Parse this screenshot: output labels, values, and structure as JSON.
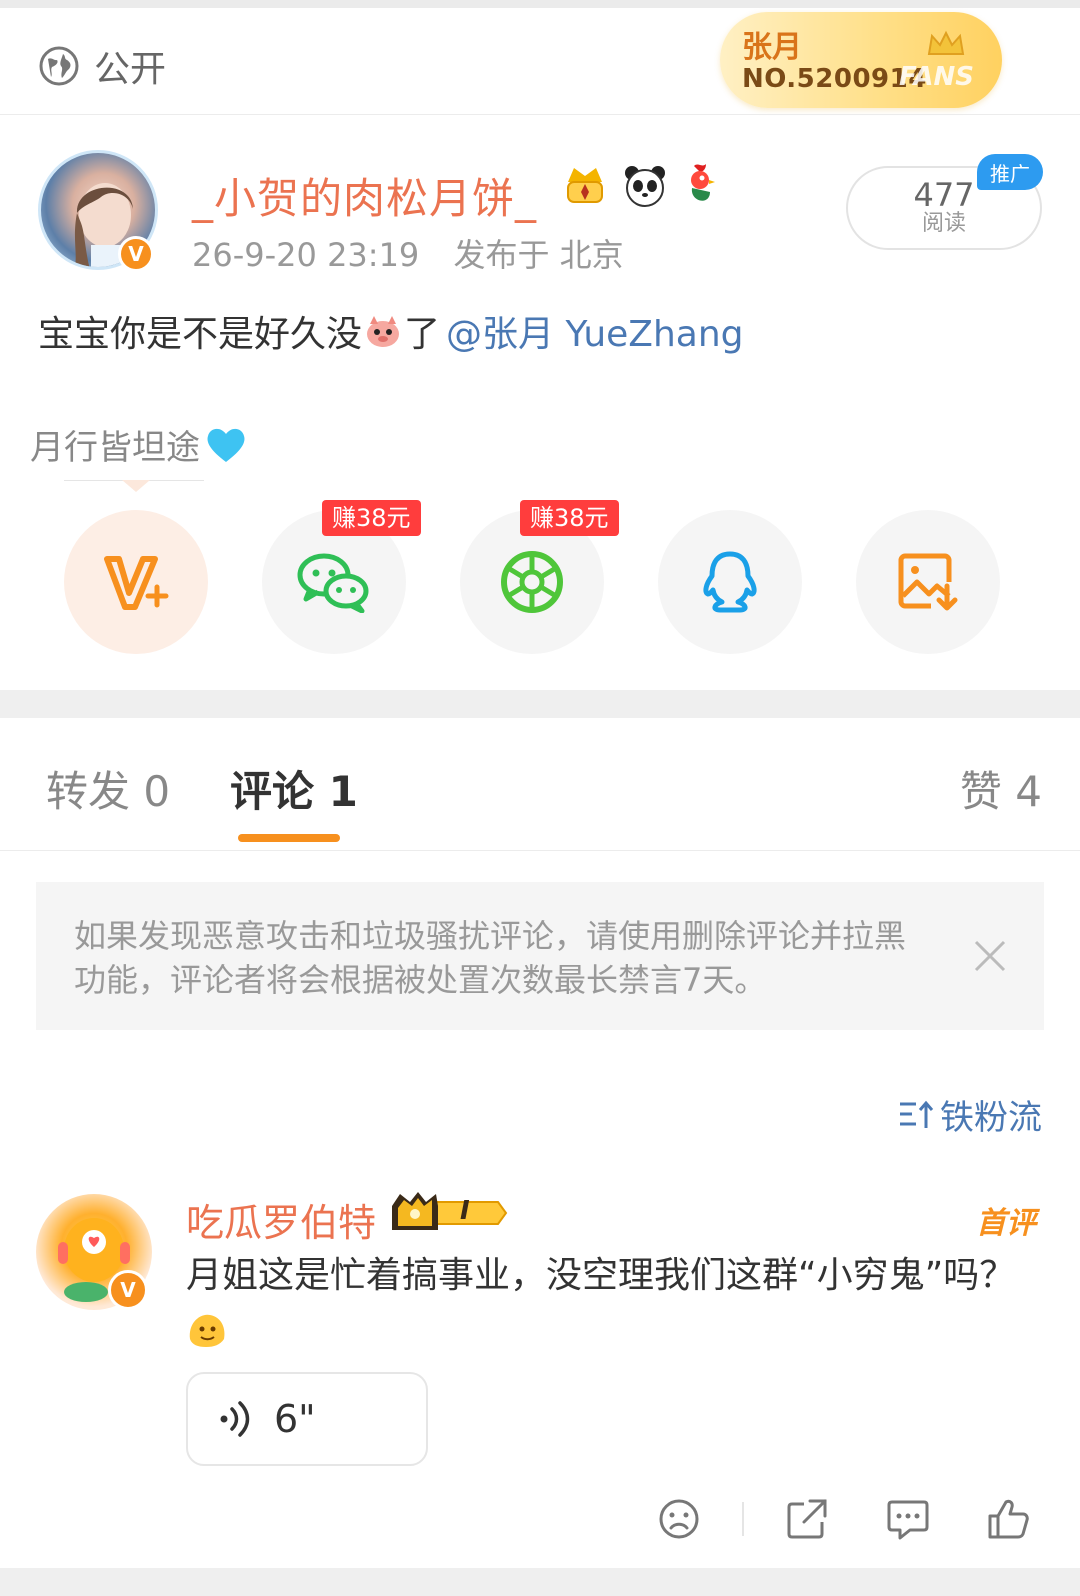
{
  "header": {
    "visibility_label": "公开",
    "fans_badge": {
      "name": "张月",
      "number": "NO.5200914",
      "tag": "FANS"
    }
  },
  "post": {
    "author": "_小贺的肉松月饼_",
    "time": "26-9-20 23:19",
    "location": "发布于 北京",
    "reads_count": "477",
    "reads_label": "阅读",
    "promo_label": "推广",
    "text_before": "宝宝你是不是好久没",
    "text_after": "了",
    "mention": "@张月 YueZhang",
    "signature": "月行皆坦途",
    "user_icons": [
      "crown-medal-icon",
      "panda-icon",
      "rooster-icon"
    ]
  },
  "share": {
    "buttons": [
      {
        "name": "weibo-vplus",
        "icon": "vplus-icon"
      },
      {
        "name": "wechat",
        "icon": "wechat-icon",
        "earn": "赚38元"
      },
      {
        "name": "moments",
        "icon": "moments-icon",
        "earn": "赚38元"
      },
      {
        "name": "qq",
        "icon": "qq-icon"
      },
      {
        "name": "save-image",
        "icon": "save-image-icon"
      }
    ]
  },
  "tabs": {
    "repost": "转发 0",
    "comment": "评论 1",
    "like": "赞 4"
  },
  "notice": {
    "text": "如果发现恶意攻击和垃圾骚扰评论，请使用删除评论并拉黑功能，评论者将会根据被处置次数最长禁言7天。"
  },
  "sort": {
    "label": "铁粉流"
  },
  "comment": {
    "author": "吃瓜罗伯特",
    "level": "I",
    "first_tag": "首评",
    "text": "月姐这是忙着搞事业，没空理我们这群“小穷鬼”吗？",
    "voice_duration": "6\""
  },
  "colors": {
    "brand_orange": "#f7901e",
    "username": "#eb7350",
    "link_blue": "#4a78b3",
    "earn_red": "#ff3d3d"
  }
}
